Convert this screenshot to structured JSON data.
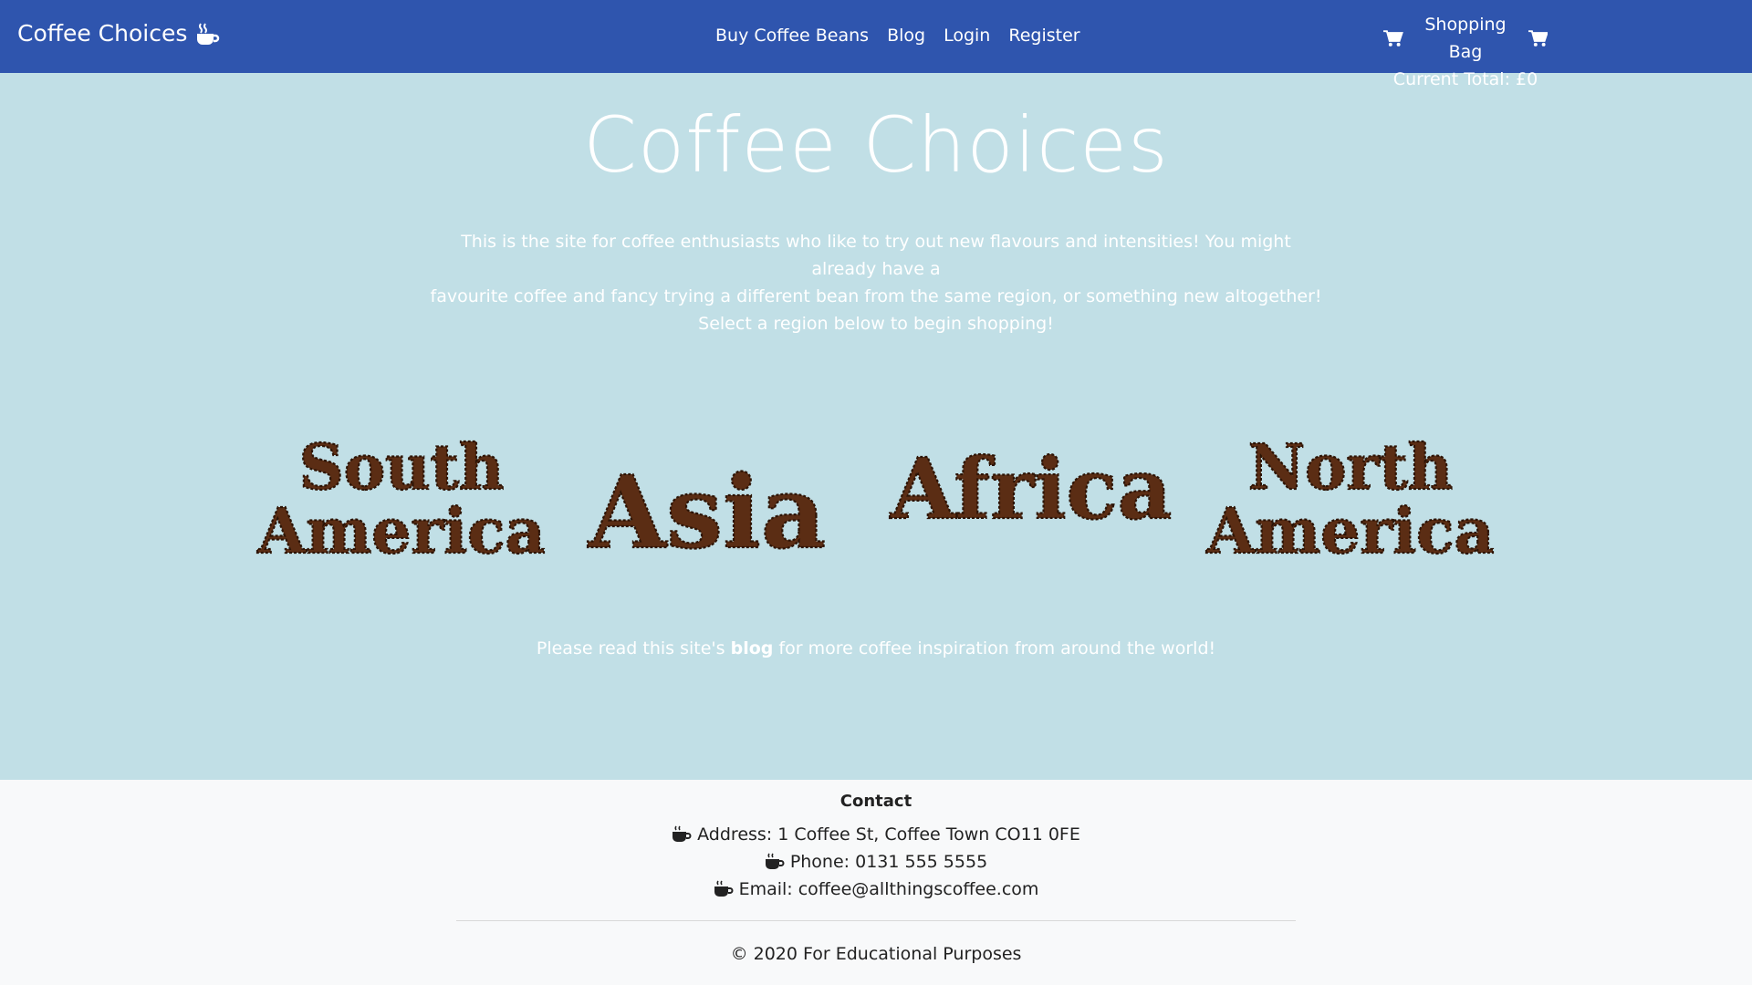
{
  "nav": {
    "brand": "Coffee Choices",
    "links": [
      "Buy Coffee Beans",
      "Blog",
      "Login",
      "Register"
    ],
    "bag_label": "Shopping Bag",
    "total": "Current Total: £0",
    "icons": [
      "coffee-cup-icon",
      "shopping-cart-icon"
    ]
  },
  "hero": {
    "title": "Coffee Choices",
    "intro_line1": "This is the site for coffee enthusiasts who like to try out new flavours and intensities! You might already have a",
    "intro_line2": "favourite coffee and fancy trying a different bean from the same region, or something new altogether!",
    "intro_line3": "Select a region below to begin shopping!"
  },
  "regions": [
    {
      "line1": "South",
      "line2": "America"
    },
    {
      "line1": "Asia",
      "line2": ""
    },
    {
      "line1": "Africa",
      "line2": ""
    },
    {
      "line1": "North",
      "line2": "America"
    }
  ],
  "blog_note": {
    "before": "Please read this site's ",
    "link": "blog",
    "after": " for more coffee inspiration from around the world!"
  },
  "footer": {
    "heading": "Contact",
    "address": "Address: 1 Coffee St, Coffee Town CO11 0FE",
    "phone": "Phone: 0131 555 5555",
    "email": "Email: coffee@allthingscoffee.com",
    "copyright": "© 2020 For Educational Purposes"
  },
  "colors": {
    "navbar": "#2f55ae",
    "page_background": "#c1dfe6",
    "footer_background": "#f8f9fa",
    "coffee_bean": "#5b2d14"
  }
}
